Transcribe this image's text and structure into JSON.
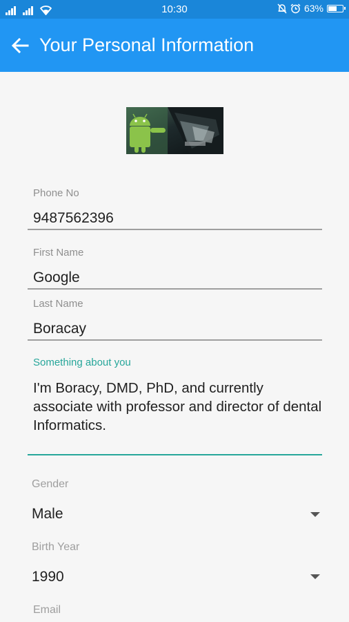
{
  "status": {
    "time": "10:30",
    "battery": "63%",
    "battery_fraction": 0.63
  },
  "toolbar": {
    "back_icon": "arrow-left-icon",
    "title": "Your Personal Information"
  },
  "avatar": {
    "description_icon": "android-robot-photo"
  },
  "form": {
    "phone": {
      "label": "Phone No",
      "value": "9487562396"
    },
    "first_name": {
      "label": "First Name",
      "value": "Google"
    },
    "last_name": {
      "label": "Last Name",
      "value": "Boracay"
    },
    "about": {
      "label": "Something about you",
      "value": "I'm Boracy, DMD,  PhD,  and currently associate with professor and director of dental Informatics."
    },
    "gender": {
      "label": "Gender",
      "value": "Male"
    },
    "birth_year": {
      "label": "Birth Year",
      "value": "1990"
    },
    "email": {
      "label": "Email"
    }
  },
  "colors": {
    "statusbar": "#1a86d9",
    "toolbar": "#2196f3",
    "accent": "#26a69a"
  }
}
